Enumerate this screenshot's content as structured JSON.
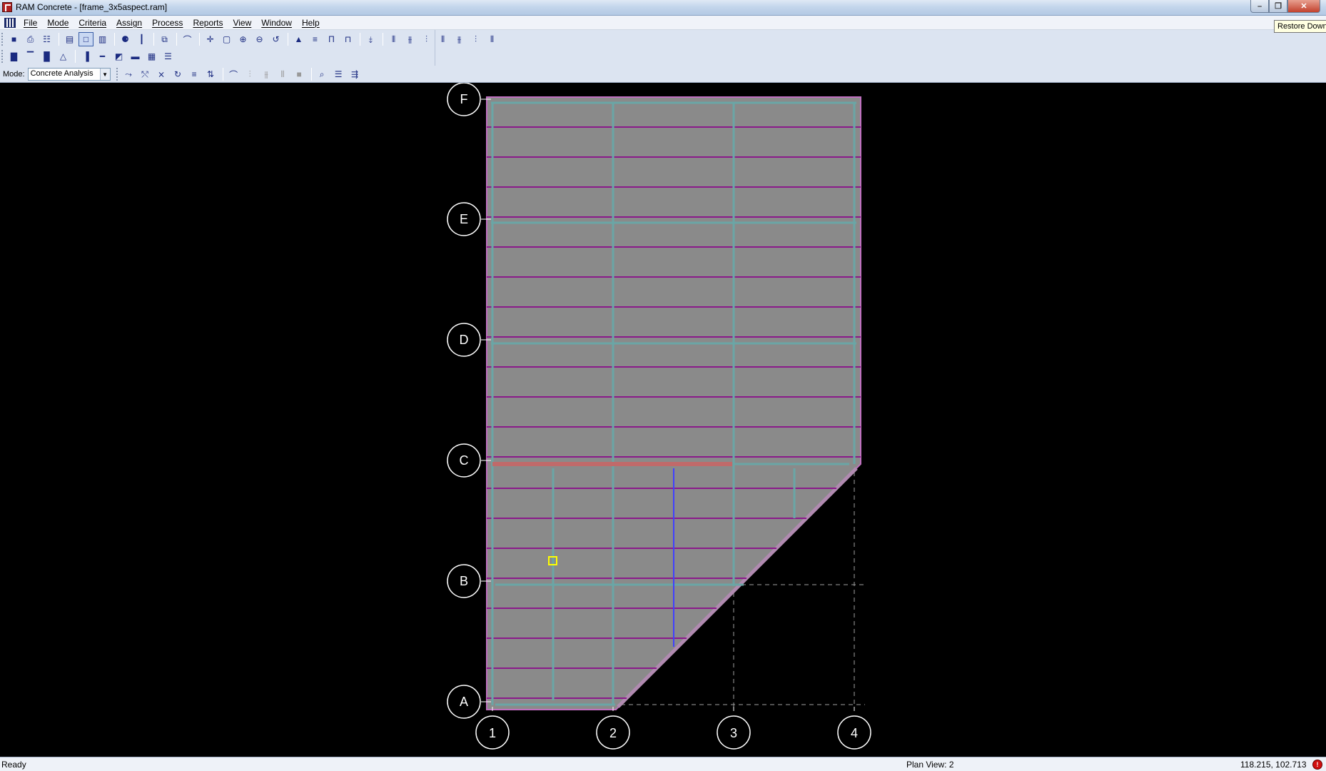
{
  "window": {
    "title": "RAM Concrete - [frame_3x5aspect.ram]",
    "tooltip": "Restore Down",
    "min_glyph": "–",
    "restore_glyph": "❐",
    "close_glyph": "✕"
  },
  "menu": [
    "File",
    "Mode",
    "Criteria",
    "Assign",
    "Process",
    "Reports",
    "View",
    "Window",
    "Help"
  ],
  "toolbar": {
    "mode_label": "Mode:",
    "mode_value": "Concrete Analysis",
    "row1_icons": [
      "save-icon",
      "print-icon",
      "report-icon",
      "sep",
      "frame-view-icon",
      "plan-view-icon",
      "elevation-view-icon",
      "sep",
      "find-icon",
      "member-info-icon",
      "sep",
      "section-icon",
      "sep",
      "draw-icon",
      "sep",
      "pan-icon",
      "zoom-window-icon",
      "zoom-in-icon",
      "zoom-out-icon",
      "zoom-previous-icon",
      "sep",
      "story-up-icon",
      "story-icon",
      "column-icon",
      "frame-icon",
      "sep",
      "frame-info-icon",
      "sep",
      "beam-design-1-icon",
      "beam-design-2-icon",
      "beam-design-3-icon",
      "beam-design-4-icon",
      "beam-design-5-icon",
      "beam-design-6-icon",
      "beam-design-7-icon"
    ],
    "row2_icons": [
      "column-mode-icon",
      "beam-mode-icon",
      "wall-mode-icon",
      "footing-mode-icon",
      "sep",
      "column-design-icon",
      "beam-design-icon",
      "slab-icon",
      "foundation-icon",
      "grid-icon",
      "table-icon"
    ],
    "row3_icons": [
      "moment-icon",
      "shear-icon",
      "axial-icon",
      "torsion-icon",
      "load-table-icon",
      "reaction-icon",
      "sep",
      "deflection-icon",
      "envelope-icon",
      "combo-icon",
      "diagram-icon",
      "stop-icon",
      "sep",
      "results-icon",
      "view-results-icon",
      "export-icon"
    ],
    "row3_disabled": [
      "envelope-icon",
      "combo-icon",
      "diagram-icon",
      "stop-icon"
    ]
  },
  "plan": {
    "grid_rows": [
      "A",
      "B",
      "C",
      "D",
      "E",
      "F"
    ],
    "grid_cols": [
      "1",
      "2",
      "3",
      "4"
    ],
    "colors": {
      "background": "#000000",
      "slab": "#8a8a8a",
      "slab_edge": "#c070c0",
      "beam": "#6aa6a6",
      "deck_line": "#8a1a8a",
      "grid_dash": "#a0a0a0",
      "bubble": "#ffffff",
      "red_beam": "#c06a6a",
      "blue_beam": "#4040ff",
      "selection": "#ffff00"
    }
  },
  "status": {
    "left": "Ready",
    "view": "Plan View: 2",
    "coords": "118.215, 102.713"
  }
}
